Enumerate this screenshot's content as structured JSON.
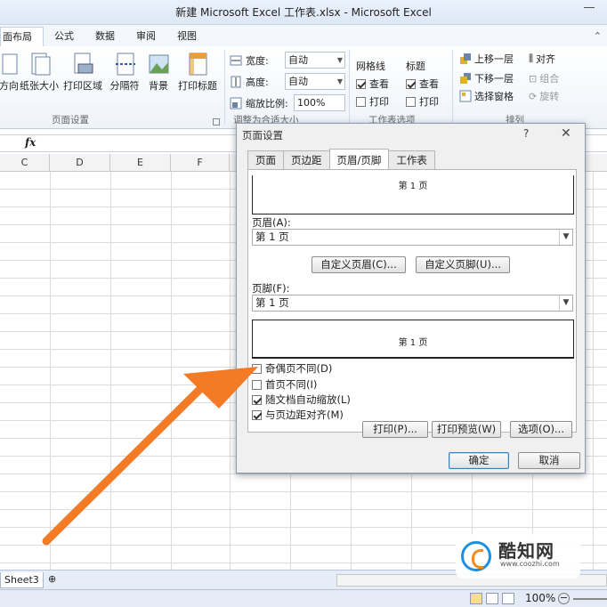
{
  "window": {
    "title": "新建 Microsoft Excel 工作表.xlsx - Microsoft Excel"
  },
  "ribbon_tabs": [
    "面布局",
    "公式",
    "数据",
    "审阅",
    "视图"
  ],
  "ribbon": {
    "page_setup": {
      "buttons": [
        "方向",
        "纸张大小",
        "打印区域",
        "分隔符",
        "背景",
        "打印标题"
      ],
      "label": "页面设置"
    },
    "scale_to_fit": {
      "width_label": "宽度:",
      "width_value": "自动",
      "height_label": "高度:",
      "height_value": "自动",
      "scale_label": "缩放比例:",
      "scale_value": "100%",
      "label": "调整为合适大小"
    },
    "sheet_options": {
      "gridlines_label": "网格线",
      "headings_label": "标题",
      "view_label": "查看",
      "print_label": "打印",
      "label": "工作表选项"
    },
    "arrange": {
      "bring_forward": "上移一层",
      "send_backward": "下移一层",
      "selection_pane": "选择窗格",
      "align": "对齐",
      "group": "组合",
      "rotate": "旋转",
      "label": "排列"
    }
  },
  "formula_bar": {
    "fx": "fx"
  },
  "columns": [
    "C",
    "D",
    "E",
    "F"
  ],
  "sheet_tab": "Sheet3",
  "status": {
    "zoom": "100%"
  },
  "dialog": {
    "title": "页面设置",
    "help": "?",
    "close": "✕",
    "tabs": [
      "页面",
      "页边距",
      "页眉/页脚",
      "工作表"
    ],
    "header_preview": "第 1 页",
    "header_label": "页眉(A):",
    "header_value": "第 1 页",
    "custom_header": "自定义页眉(C)...",
    "custom_footer": "自定义页脚(U)...",
    "footer_label": "页脚(F):",
    "footer_value": "第 1 页",
    "footer_preview": "第 1 页",
    "options": [
      {
        "label": "奇偶页不同(D)",
        "checked": false
      },
      {
        "label": "首页不同(I)",
        "checked": false
      },
      {
        "label": "随文档自动缩放(L)",
        "checked": true
      },
      {
        "label": "与页边距对齐(M)",
        "checked": true
      }
    ],
    "print_button": "打印(P)...",
    "preview_button": "打印预览(W)",
    "options_button": "选项(O)...",
    "ok_button": "确定",
    "cancel_button": "取消"
  },
  "watermark": {
    "name": "酷知网",
    "url": "www.coozhi.com"
  },
  "colors": {
    "arrow": "#f47b26",
    "accent": "#1d8fe0"
  }
}
